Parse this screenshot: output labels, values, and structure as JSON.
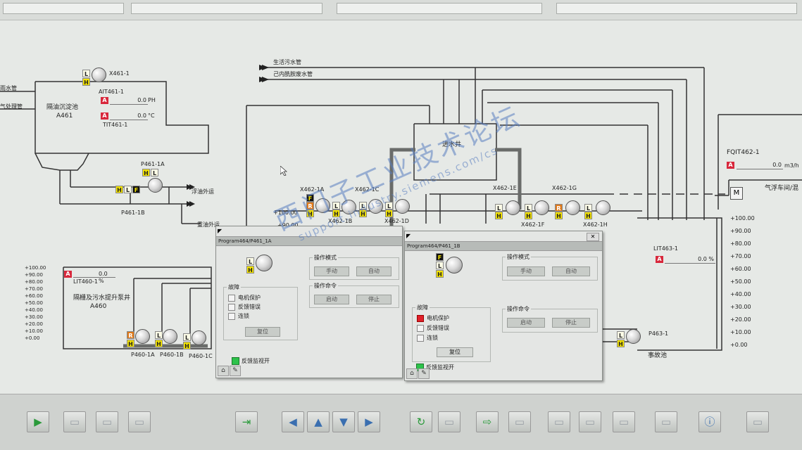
{
  "window": {
    "background": "#e6e9e6",
    "alarm_color": "#d8283c",
    "indicator_colors": {
      "L": "#fbfbe6",
      "H": "#f4e400",
      "R": "#e07a1a",
      "F": "#111111"
    }
  },
  "left_area": {
    "inlet_1": "雨水管",
    "inlet_2": "气处理管",
    "tank_a461": {
      "title": "隔油沉淀池",
      "code": "A461",
      "agitator_tag": "X461-1",
      "analyzer_tag": "AIT461-1",
      "analyzer_value": "0.0",
      "analyzer_unit": "PH",
      "temp_tag": "TIT461-1",
      "temp_value": "0.0",
      "temp_unit": "°C"
    },
    "pump_p461_1a": "P461-1A",
    "pump_p461_1b": "P461-1B",
    "oil_out_float": "浮油外运",
    "oil_out_heavy": "重油外运"
  },
  "sewage_pipe": "生活污水管",
  "lactam_pipe": "己内酰胺废水管",
  "inlet_well": "进水井",
  "agitators": [
    {
      "tag": "X462-1A"
    },
    {
      "tag": "X462-1B"
    },
    {
      "tag": "X462-1C"
    },
    {
      "tag": "X462-1D"
    },
    {
      "tag": "X462-1E"
    },
    {
      "tag": "X462-1F"
    },
    {
      "tag": "X462-1G"
    },
    {
      "tag": "X462-1H"
    }
  ],
  "scale_small": [
    "+100.00",
    "+90.00"
  ],
  "flow_meter": {
    "tag": "FQIT462-1",
    "value": "0.0",
    "unit": "m3/h"
  },
  "gas_line": "气浮车间/混",
  "meter_symbol": "M",
  "tank_a460": {
    "level_value": "0.0",
    "level_unit": "%",
    "level_tag": "LIT460-1",
    "title": "隔栅及污水提升泵井",
    "code": "A460",
    "pumps": [
      "P460-1A",
      "P460-1B",
      "P460-1C"
    ],
    "scale": [
      "+100.00",
      "+90.00",
      "+80.00",
      "+70.00",
      "+60.00",
      "+50.00",
      "+40.00",
      "+30.00",
      "+20.00",
      "+10.00",
      "+0.00"
    ]
  },
  "tank_lit463": {
    "level_tag": "LIT463-1",
    "level_value": "0.0",
    "level_unit": "%",
    "pump": "P463-1",
    "name": "事故池",
    "scale": [
      "+100.00",
      "+90.00",
      "+80.00",
      "+70.00",
      "+60.00",
      "+50.00",
      "+40.00",
      "+30.00",
      "+20.00",
      "+10.00",
      "+0.00"
    ]
  },
  "dialog_1a": {
    "title": "Program464/P461_1A",
    "close": "✕",
    "mode_group": "操作模式",
    "mode_btn_manual": "手动",
    "mode_btn_auto": "自动",
    "cmd_group": "操作命令",
    "cmd_btn_start": "启动",
    "cmd_btn_stop": "停止",
    "fault_group": "故障",
    "fault_items": [
      "电机保护",
      "反馈错误",
      "连锁"
    ],
    "reset_btn": "复位",
    "feedback": "反馈监视开",
    "foot_home": "⌂",
    "foot_tool": "✎"
  },
  "dialog_1b": {
    "title": "Program464/P461_1B",
    "close": "✕",
    "mode_group": "操作模式",
    "mode_btn_manual": "手动",
    "mode_btn_auto": "自动",
    "cmd_group": "操作命令",
    "cmd_btn_start": "启动",
    "cmd_btn_stop": "停止",
    "fault_group": "故障",
    "fault_items": [
      "电机保护",
      "反馈错误",
      "连锁"
    ],
    "fault_active": "电机保护",
    "reset_btn": "复位",
    "feedback": "反馈监视开",
    "foot_home": "⌂",
    "foot_tool": "✎"
  },
  "watermark": {
    "line1": "西门子工业技术论坛",
    "line2": "support.industry.siemens.com/cs",
    "color": "#5a7fc0"
  },
  "bottom_toolbar": {
    "icons": [
      "play-icon",
      "dim-icon",
      "dim-icon",
      "dim-icon",
      "exit-icon",
      "arrow-left-icon",
      "arrow-up-icon",
      "arrow-down-icon",
      "arrow-right-icon",
      "refresh-icon",
      "dim-icon",
      "next-screen-icon",
      "dim-icon",
      "dim-icon",
      "dim-icon",
      "dim-icon",
      "dim-icon",
      "info-icon",
      "dim-icon"
    ],
    "glyph_play": "▶",
    "glyph_exit": "⇥",
    "glyph_left": "◀",
    "glyph_up": "▲",
    "glyph_down": "▼",
    "glyph_right": "▶",
    "glyph_refresh": "↻",
    "glyph_next": "⇨",
    "glyph_info": "ⓘ",
    "glyph_dim": "▭"
  }
}
